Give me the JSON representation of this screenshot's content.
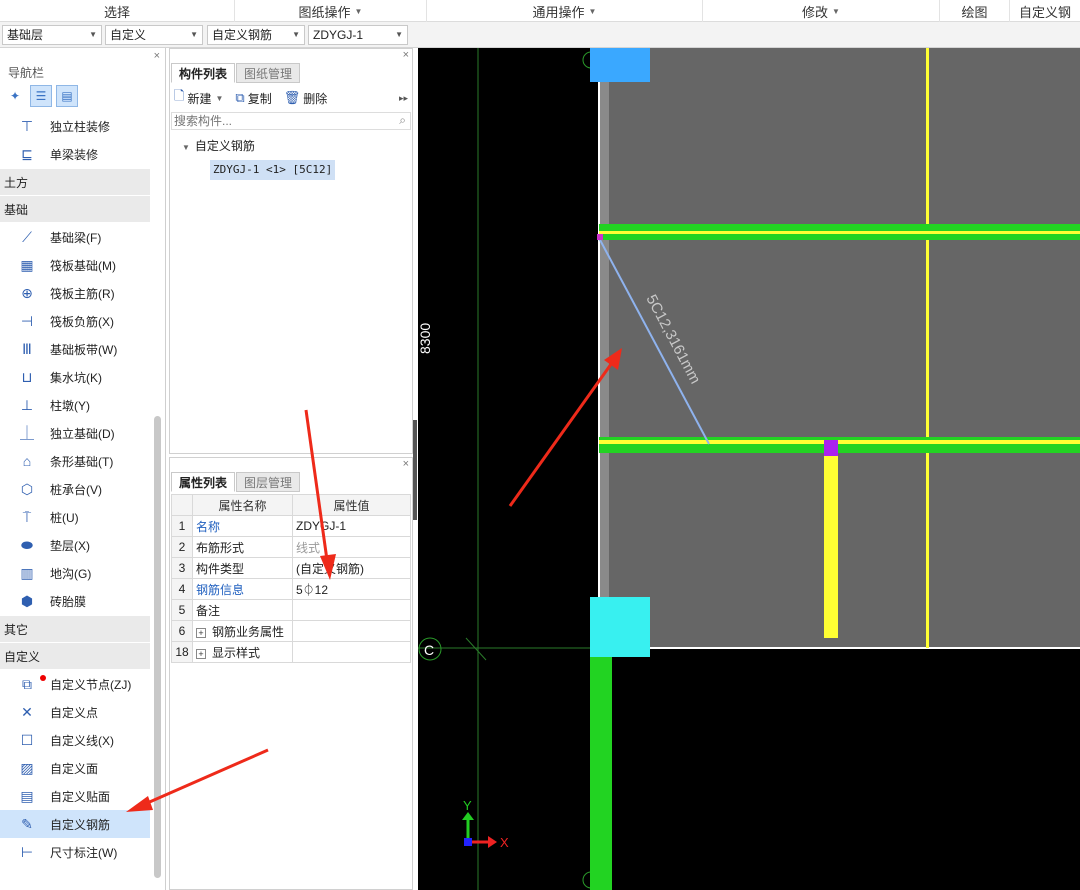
{
  "ribbon": {
    "groups": [
      {
        "label": "选择",
        "dropdown": false
      },
      {
        "label": "图纸操作",
        "dropdown": true
      },
      {
        "label": "通用操作",
        "dropdown": true
      },
      {
        "label": "修改",
        "dropdown": true
      },
      {
        "label": "绘图",
        "dropdown": false
      },
      {
        "label": "自定义钢",
        "dropdown": false
      }
    ]
  },
  "selectors": {
    "floor": "基础层",
    "category": "自定义",
    "type": "自定义钢筋",
    "component": "ZDYGJ-1"
  },
  "nav": {
    "title": "导航栏",
    "close": "×",
    "top_items": [
      {
        "label": "独立柱装修",
        "icon": "column-decor-icon"
      },
      {
        "label": "单梁装修",
        "icon": "beam-decor-icon"
      }
    ],
    "categories": {
      "earthwork": "土方",
      "foundation": "基础",
      "other": "其它",
      "custom": "自定义"
    },
    "foundation_items": [
      {
        "label": "基础梁(F)"
      },
      {
        "label": "筏板基础(M)"
      },
      {
        "label": "筏板主筋(R)"
      },
      {
        "label": "筏板负筋(X)"
      },
      {
        "label": "基础板带(W)"
      },
      {
        "label": "集水坑(K)"
      },
      {
        "label": "柱墩(Y)"
      },
      {
        "label": "独立基础(D)"
      },
      {
        "label": "条形基础(T)"
      },
      {
        "label": "桩承台(V)"
      },
      {
        "label": "桩(U)"
      },
      {
        "label": "垫层(X)"
      },
      {
        "label": "地沟(G)"
      },
      {
        "label": "砖胎膜"
      }
    ],
    "custom_items": [
      {
        "label": "自定义节点(ZJ)"
      },
      {
        "label": "自定义点"
      },
      {
        "label": "自定义线(X)"
      },
      {
        "label": "自定义面"
      },
      {
        "label": "自定义贴面"
      },
      {
        "label": "自定义钢筋"
      },
      {
        "label": "尺寸标注(W)"
      }
    ]
  },
  "component_panel": {
    "tabs": [
      "构件列表",
      "图纸管理"
    ],
    "toolbar": {
      "new": "新建",
      "copy": "复制",
      "delete": "删除"
    },
    "search_placeholder": "搜索构件...",
    "tree_root": "自定义钢筋",
    "tree_leaf": "ZDYGJ-1 <1> [5C12]"
  },
  "property_panel": {
    "tabs": [
      "属性列表",
      "图层管理"
    ],
    "headers": [
      "属性名称",
      "属性值"
    ],
    "rows": [
      {
        "num": "1",
        "name": "名称",
        "value": "ZDYGJ-1"
      },
      {
        "num": "2",
        "name": "布筋形式",
        "value": "线式"
      },
      {
        "num": "3",
        "name": "构件类型",
        "value": "(自定义钢筋)"
      },
      {
        "num": "4",
        "name": "钢筋信息",
        "value": "5⏀12"
      },
      {
        "num": "5",
        "name": "备注",
        "value": ""
      },
      {
        "num": "6",
        "name": "钢筋业务属性",
        "value": ""
      },
      {
        "num": "18",
        "name": "显示样式",
        "value": ""
      }
    ]
  },
  "canvas": {
    "dimension_label": "8300",
    "rebar_label": "5C12,3161mm",
    "axis_label": "C",
    "axis_y": "Y",
    "axis_x": "X",
    "colors": {
      "background": "#000000",
      "slab": "#666666",
      "green": "#22d322",
      "yellow": "#ffff33",
      "cyan": "#38f0f0",
      "blue_cap": "#3aa8ff",
      "magenta": "#aa22ee",
      "rebar": "#8fb3ee",
      "arrow": "#ee2a1a"
    }
  }
}
